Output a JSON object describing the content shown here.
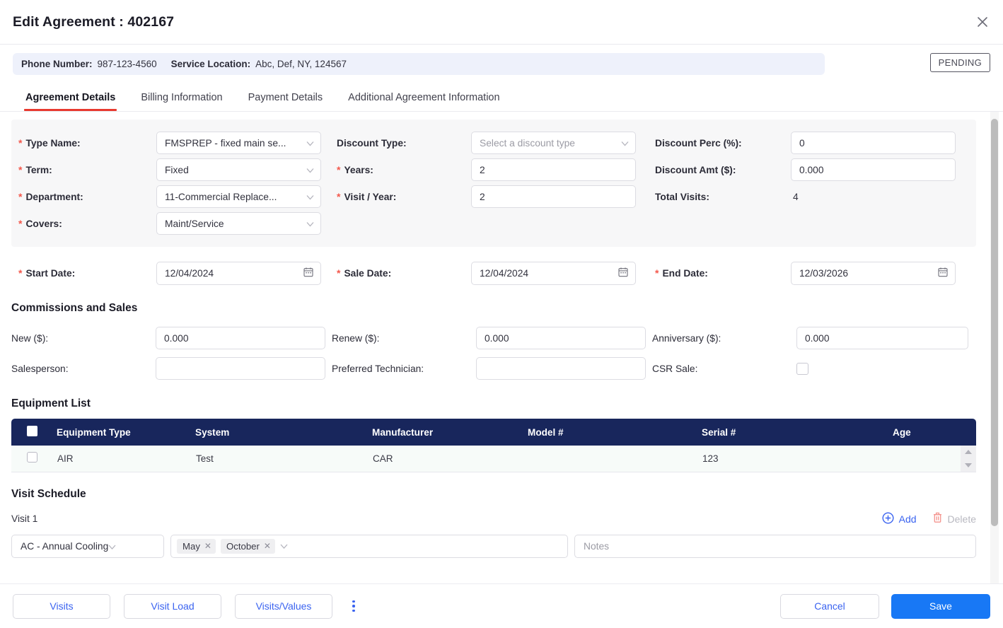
{
  "header": {
    "title": "Edit Agreement : 402167",
    "close_label": "×"
  },
  "info": {
    "phone_label": "Phone Number:",
    "phone_value": "987-123-4560",
    "location_label": "Service Location:",
    "location_value": "Abc, Def, NY, 124567",
    "status": "PENDING"
  },
  "tabs": [
    {
      "label": "Agreement Details",
      "active": true
    },
    {
      "label": "Billing Information",
      "active": false
    },
    {
      "label": "Payment Details",
      "active": false
    },
    {
      "label": "Additional Agreement Information",
      "active": false
    }
  ],
  "agreement": {
    "type_name_label": "Type Name:",
    "type_name_value": "FMSPREP - fixed main se...",
    "term_label": "Term:",
    "term_value": "Fixed",
    "department_label": "Department:",
    "department_value": "11-Commercial Replace...",
    "covers_label": "Covers:",
    "covers_value": "Maint/Service",
    "discount_type_label": "Discount Type:",
    "discount_type_placeholder": "Select a discount type",
    "years_label": "Years:",
    "years_value": "2",
    "visit_year_label": "Visit / Year:",
    "visit_year_value": "2",
    "discount_perc_label": "Discount Perc (%):",
    "discount_perc_value": "0",
    "discount_amt_label": "Discount Amt ($):",
    "discount_amt_value": "0.000",
    "total_visits_label": "Total Visits:",
    "total_visits_value": "4"
  },
  "dates": {
    "start_label": "Start Date:",
    "start_value": "12/04/2024",
    "sale_label": "Sale Date:",
    "sale_value": "12/04/2024",
    "end_label": "End Date:",
    "end_value": "12/03/2026"
  },
  "commissions": {
    "title": "Commissions and Sales",
    "new_label": "New ($):",
    "new_value": "0.000",
    "renew_label": "Renew ($):",
    "renew_value": "0.000",
    "anniversary_label": "Anniversary ($):",
    "anniversary_value": "0.000",
    "salesperson_label": "Salesperson:",
    "salesperson_value": "",
    "preferred_tech_label": "Preferred Technician:",
    "preferred_tech_value": "",
    "csr_sale_label": "CSR Sale:"
  },
  "equipment": {
    "title": "Equipment List",
    "columns": [
      "Equipment Type",
      "System",
      "Manufacturer",
      "Model #",
      "Serial #",
      "Age"
    ],
    "rows": [
      {
        "equipment_type": "AIR",
        "system": "Test",
        "manufacturer": "CAR",
        "model": "",
        "serial": "123",
        "age": ""
      }
    ]
  },
  "visit_schedule": {
    "title": "Visit Schedule",
    "visit_label": "Visit 1",
    "add_label": "Add",
    "delete_label": "Delete",
    "type_value": "AC - Annual Cooling",
    "months": [
      "May",
      "October"
    ],
    "notes_placeholder": "Notes"
  },
  "footer": {
    "visits_label": "Visits",
    "visit_load_label": "Visit Load",
    "visits_values_label": "Visits/Values",
    "cancel_label": "Cancel",
    "save_label": "Save"
  },
  "colors": {
    "accent_blue": "#1878f5",
    "link_blue": "#3a63f0",
    "tab_underline": "#e8392f",
    "table_header": "#18265c",
    "required": "#f4584c",
    "infobar_bg": "#eef1fb"
  }
}
